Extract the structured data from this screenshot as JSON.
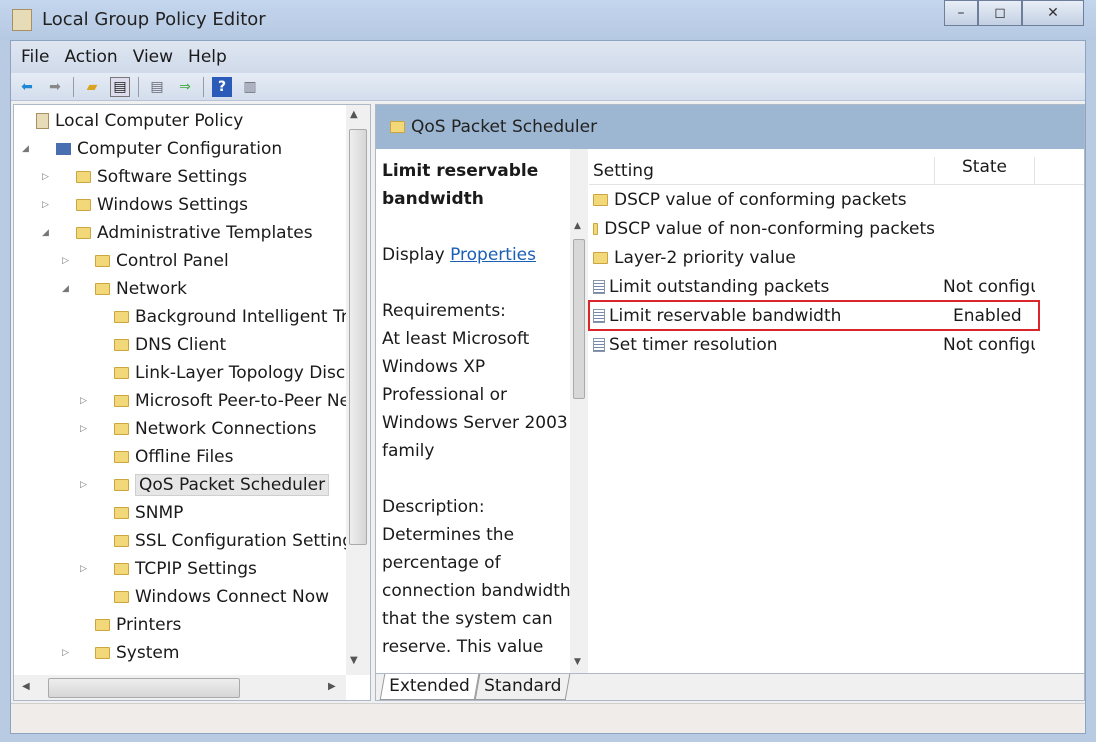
{
  "window": {
    "title": "Local Group Policy Editor",
    "minimize": "–",
    "maximize": "◻",
    "close": "✕"
  },
  "menu": [
    "File",
    "Action",
    "View",
    "Help"
  ],
  "toolbar": [
    "back-icon",
    "forward-icon",
    "up-folder-icon",
    "show-hide-tree-icon",
    "properties-icon",
    "export-list-icon",
    "help-icon",
    "show-action-pane-icon"
  ],
  "tree": [
    {
      "label": "Local Computer Policy",
      "level": 0,
      "arrow": ""
    },
    {
      "label": "Computer Configuration",
      "level": 1,
      "arrow": "◢"
    },
    {
      "label": "Software Settings",
      "level": 2,
      "arrow": "▷"
    },
    {
      "label": "Windows Settings",
      "level": 2,
      "arrow": "▷"
    },
    {
      "label": "Administrative Templates",
      "level": 2,
      "arrow": "◢"
    },
    {
      "label": "Control Panel",
      "level": 3,
      "arrow": "▷"
    },
    {
      "label": "Network",
      "level": 3,
      "arrow": "◢"
    },
    {
      "label": "Background Intelligent Transfer Service (BITS)",
      "level": 4,
      "arrow": ""
    },
    {
      "label": "DNS Client",
      "level": 4,
      "arrow": ""
    },
    {
      "label": "Link-Layer Topology Discovery",
      "level": 4,
      "arrow": ""
    },
    {
      "label": "Microsoft Peer-to-Peer Networking Services",
      "level": 4,
      "arrow": "▷"
    },
    {
      "label": "Network Connections",
      "level": 4,
      "arrow": "▷"
    },
    {
      "label": "Offline Files",
      "level": 4,
      "arrow": ""
    },
    {
      "label": "QoS Packet Scheduler",
      "level": 4,
      "arrow": "▷",
      "selected": true
    },
    {
      "label": "SNMP",
      "level": 4,
      "arrow": ""
    },
    {
      "label": "SSL Configuration Settings",
      "level": 4,
      "arrow": ""
    },
    {
      "label": "TCPIP Settings",
      "level": 4,
      "arrow": "▷"
    },
    {
      "label": "Windows Connect Now",
      "level": 4,
      "arrow": ""
    },
    {
      "label": "Printers",
      "level": 3,
      "arrow": ""
    },
    {
      "label": "System",
      "level": 3,
      "arrow": "▷"
    }
  ],
  "pane": {
    "header": "QoS Packet Scheduler"
  },
  "description": {
    "title": "Limit reservable bandwidth",
    "display_prefix": "Display",
    "display_link": "Properties",
    "requirements_label": "Requirements:",
    "requirements": "At least Microsoft Windows XP Professional or Windows Server 2003 family",
    "description_label": "Description:",
    "description": "Determines the percentage of connection bandwidth that the system can reserve. This value"
  },
  "list": {
    "columns": [
      "Setting",
      "State"
    ],
    "rows": [
      {
        "name": "DSCP value of conforming packets",
        "state": "",
        "type": "folder"
      },
      {
        "name": "DSCP value of non-conforming packets",
        "state": "",
        "type": "folder"
      },
      {
        "name": "Layer-2 priority value",
        "state": "",
        "type": "folder"
      },
      {
        "name": "Limit outstanding packets",
        "state": "Not configured",
        "type": "policy"
      },
      {
        "name": "Limit reservable bandwidth",
        "state": "Enabled",
        "type": "policy",
        "highlighted": true
      },
      {
        "name": "Set timer resolution",
        "state": "Not configured",
        "type": "policy"
      }
    ]
  },
  "tabs": [
    "Extended",
    "Standard"
  ],
  "colors": {
    "highlight_box": "#d8262b",
    "header_bg": "#9db6d1",
    "link": "#1a5fb4"
  }
}
